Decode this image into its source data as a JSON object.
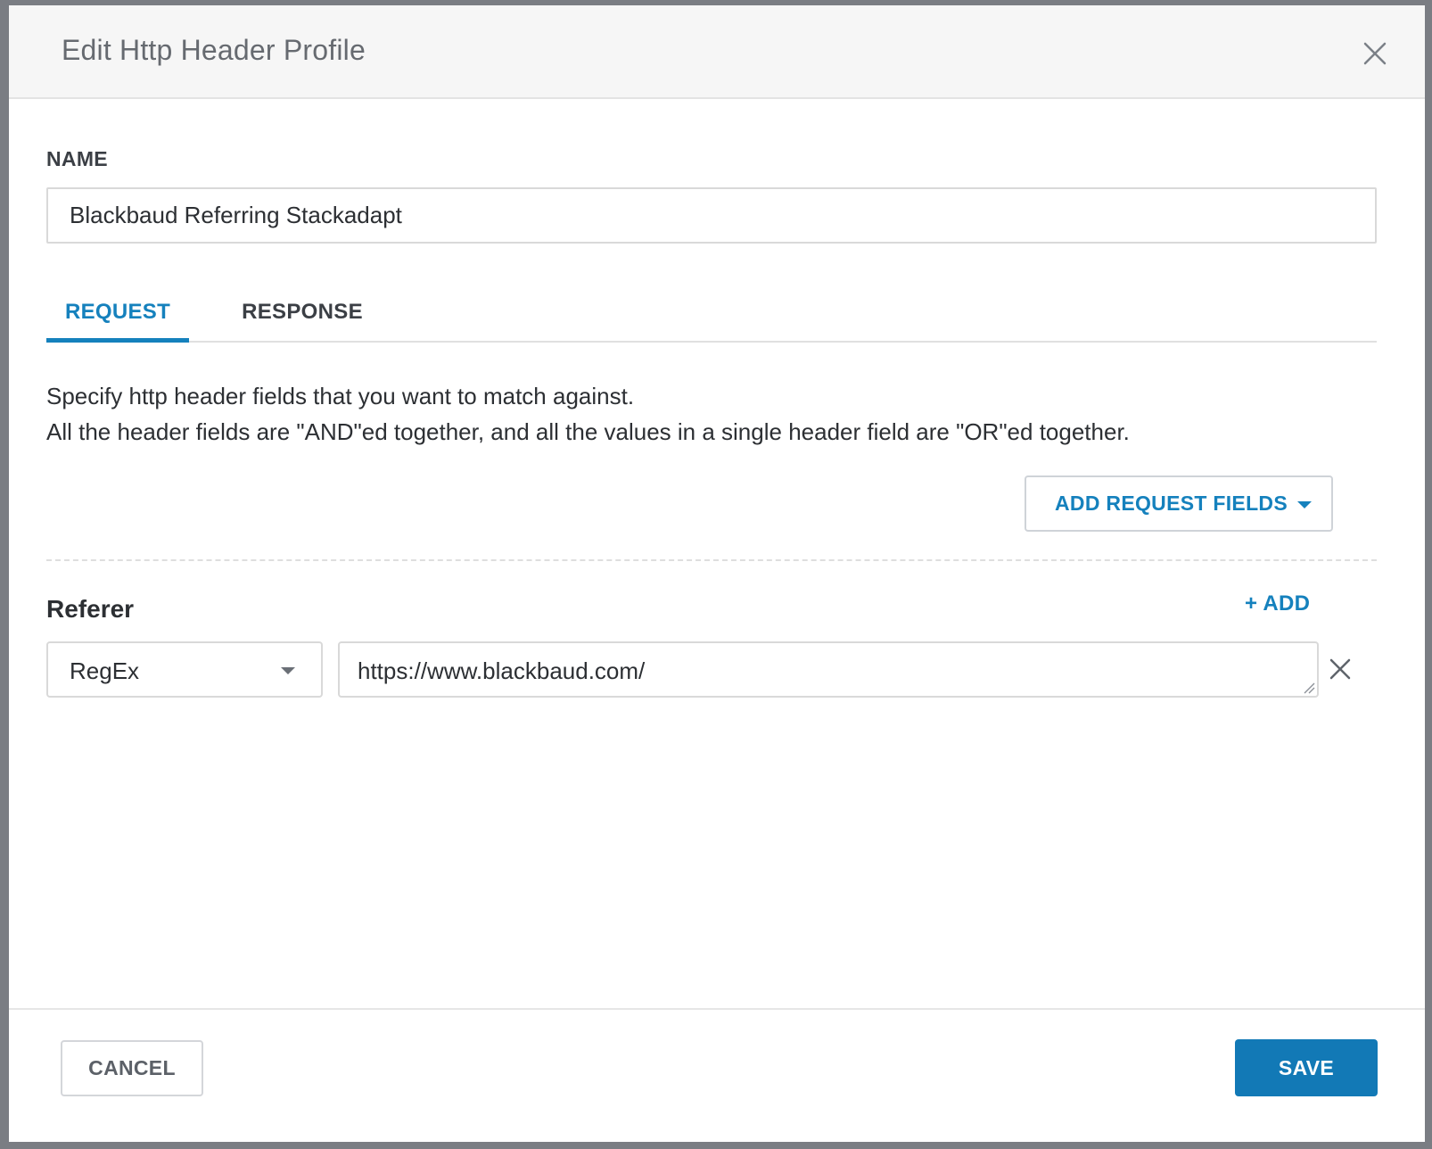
{
  "modal": {
    "title": "Edit Http Header Profile",
    "close_icon": "close-icon"
  },
  "name_field": {
    "label": "NAME",
    "value": "Blackbaud Referring Stackadapt"
  },
  "tabs": [
    {
      "label": "REQUEST",
      "active": true
    },
    {
      "label": "RESPONSE",
      "active": false
    }
  ],
  "description": {
    "line1": "Specify http header fields that you want to match against.",
    "line2": "All the header fields are \"AND\"ed together, and all the values in a single header field are \"OR\"ed together."
  },
  "add_request_fields": {
    "label": "ADD REQUEST FIELDS",
    "icon": "caret-down-icon"
  },
  "header_field": {
    "name": "Referer",
    "add_label": "+ ADD",
    "match_type": "RegEx",
    "value": "https://www.blackbaud.com/",
    "remove_icon": "close-icon"
  },
  "footer": {
    "cancel_label": "CANCEL",
    "save_label": "SAVE"
  },
  "colors": {
    "accent": "#1581bd",
    "save_button": "#1279b6",
    "backdrop": "#7a7d83",
    "header_bg": "#f6f6f6"
  }
}
